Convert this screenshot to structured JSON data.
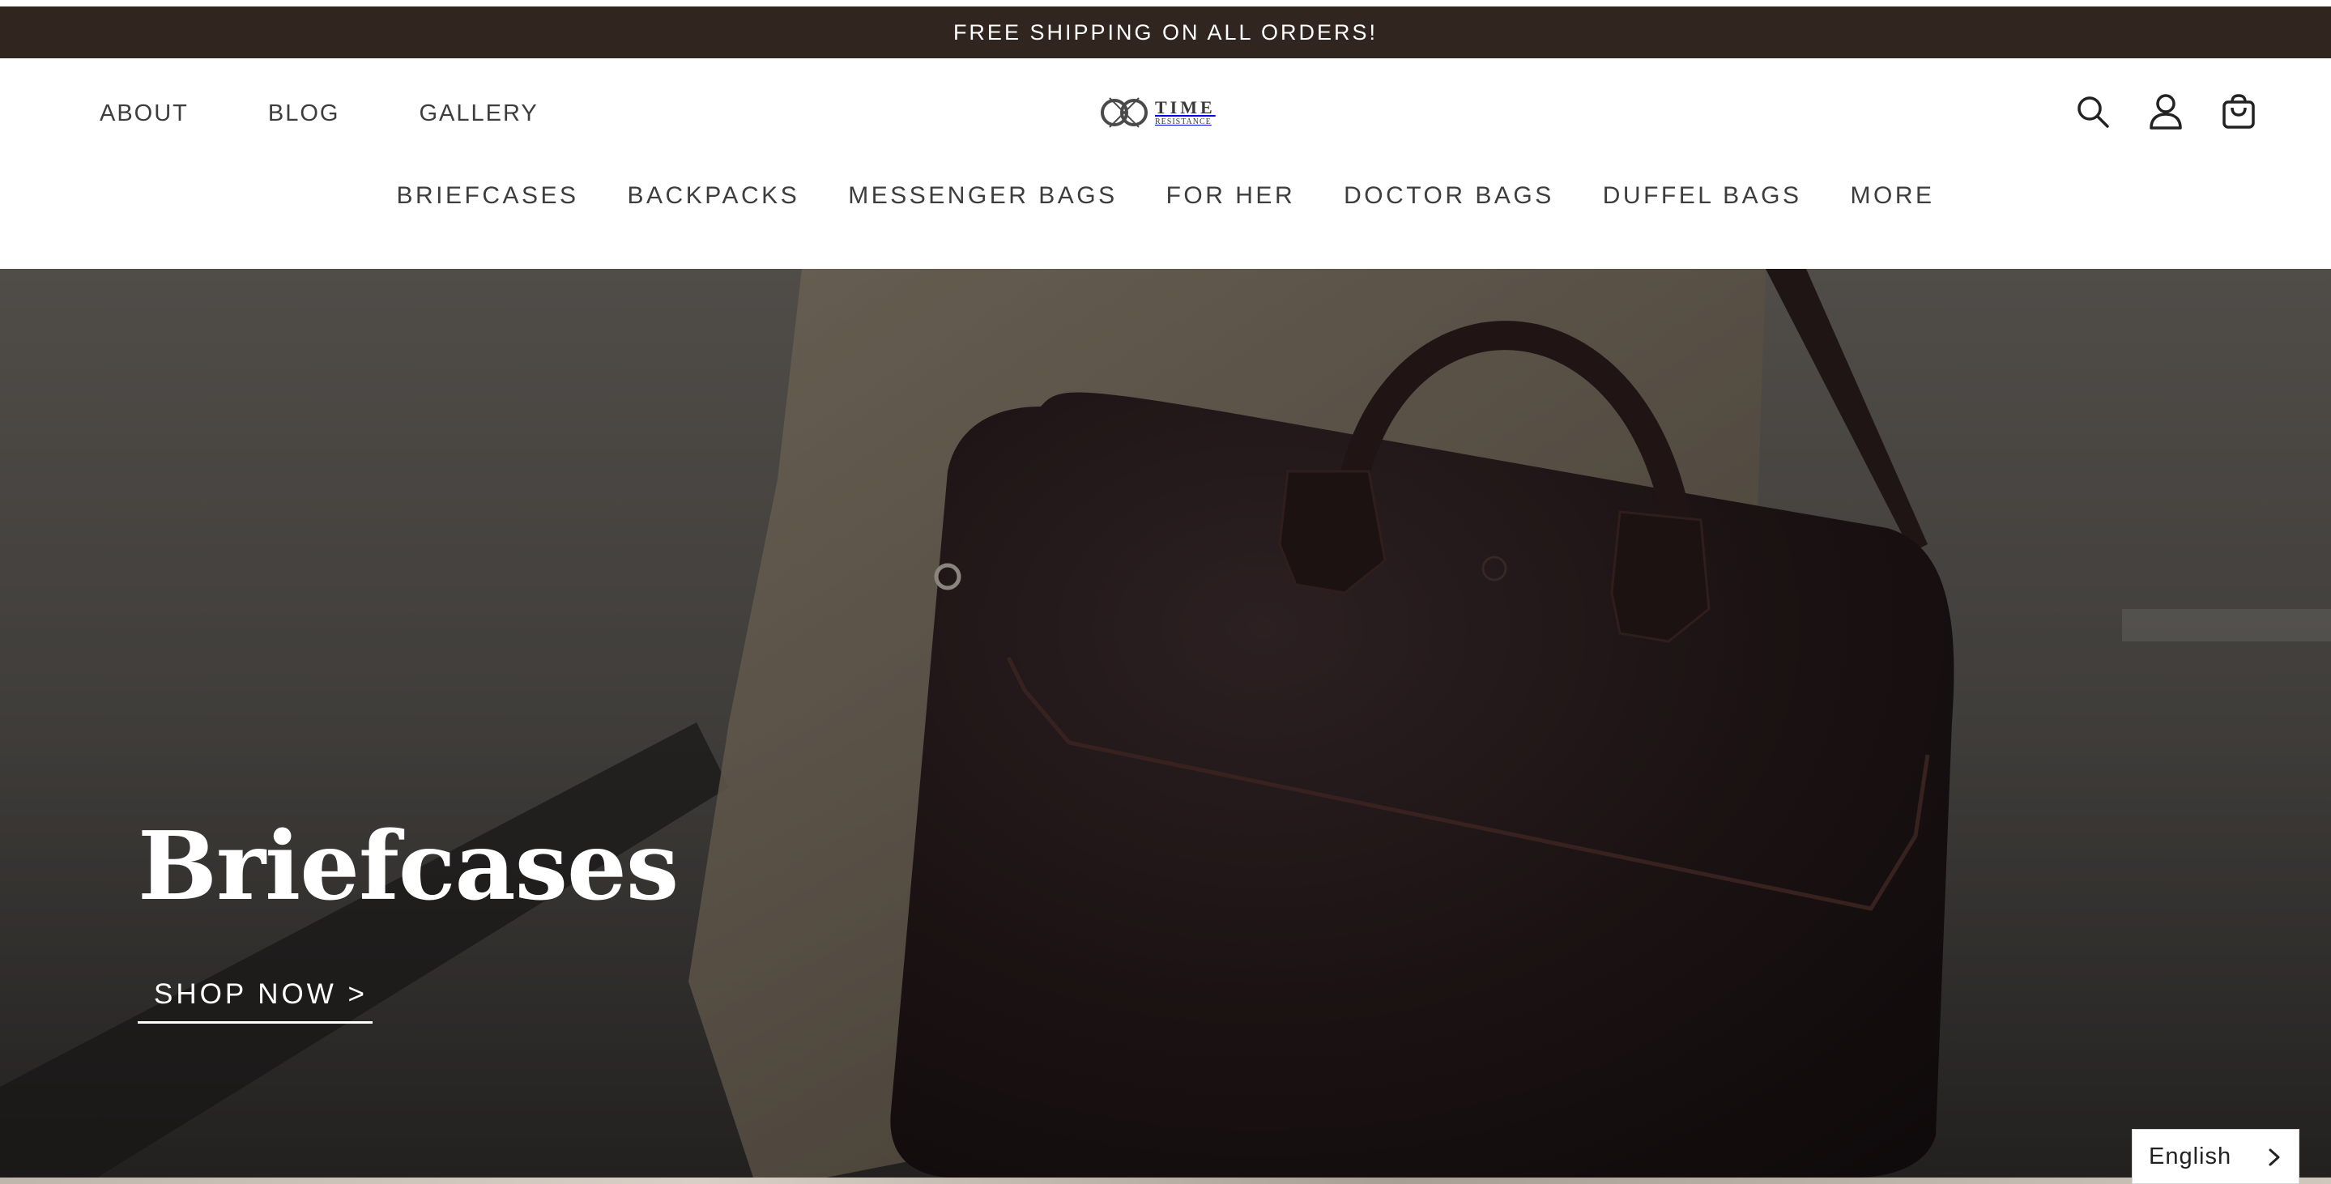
{
  "announcement": "FREE SHIPPING ON ALL ORDERS!",
  "header": {
    "left_nav": [
      {
        "label": "ABOUT"
      },
      {
        "label": "BLOG"
      },
      {
        "label": "GALLERY"
      }
    ],
    "logo": {
      "main": "TIME",
      "sub": "RESISTANCE"
    },
    "icons": [
      "search-icon",
      "account-icon",
      "cart-icon"
    ]
  },
  "main_nav": [
    {
      "label": "BRIEFCASES"
    },
    {
      "label": "BACKPACKS"
    },
    {
      "label": "MESSENGER BAGS"
    },
    {
      "label": "FOR HER"
    },
    {
      "label": "DOCTOR BAGS"
    },
    {
      "label": "DUFFEL BAGS"
    },
    {
      "label": "MORE"
    }
  ],
  "hero": {
    "title": "Briefcases",
    "cta": "SHOP NOW >"
  },
  "language": {
    "current": "English"
  },
  "colors": {
    "announcement_bg": "#30261f",
    "text": "#3d3d3d",
    "bag": "#2a1d1c"
  }
}
